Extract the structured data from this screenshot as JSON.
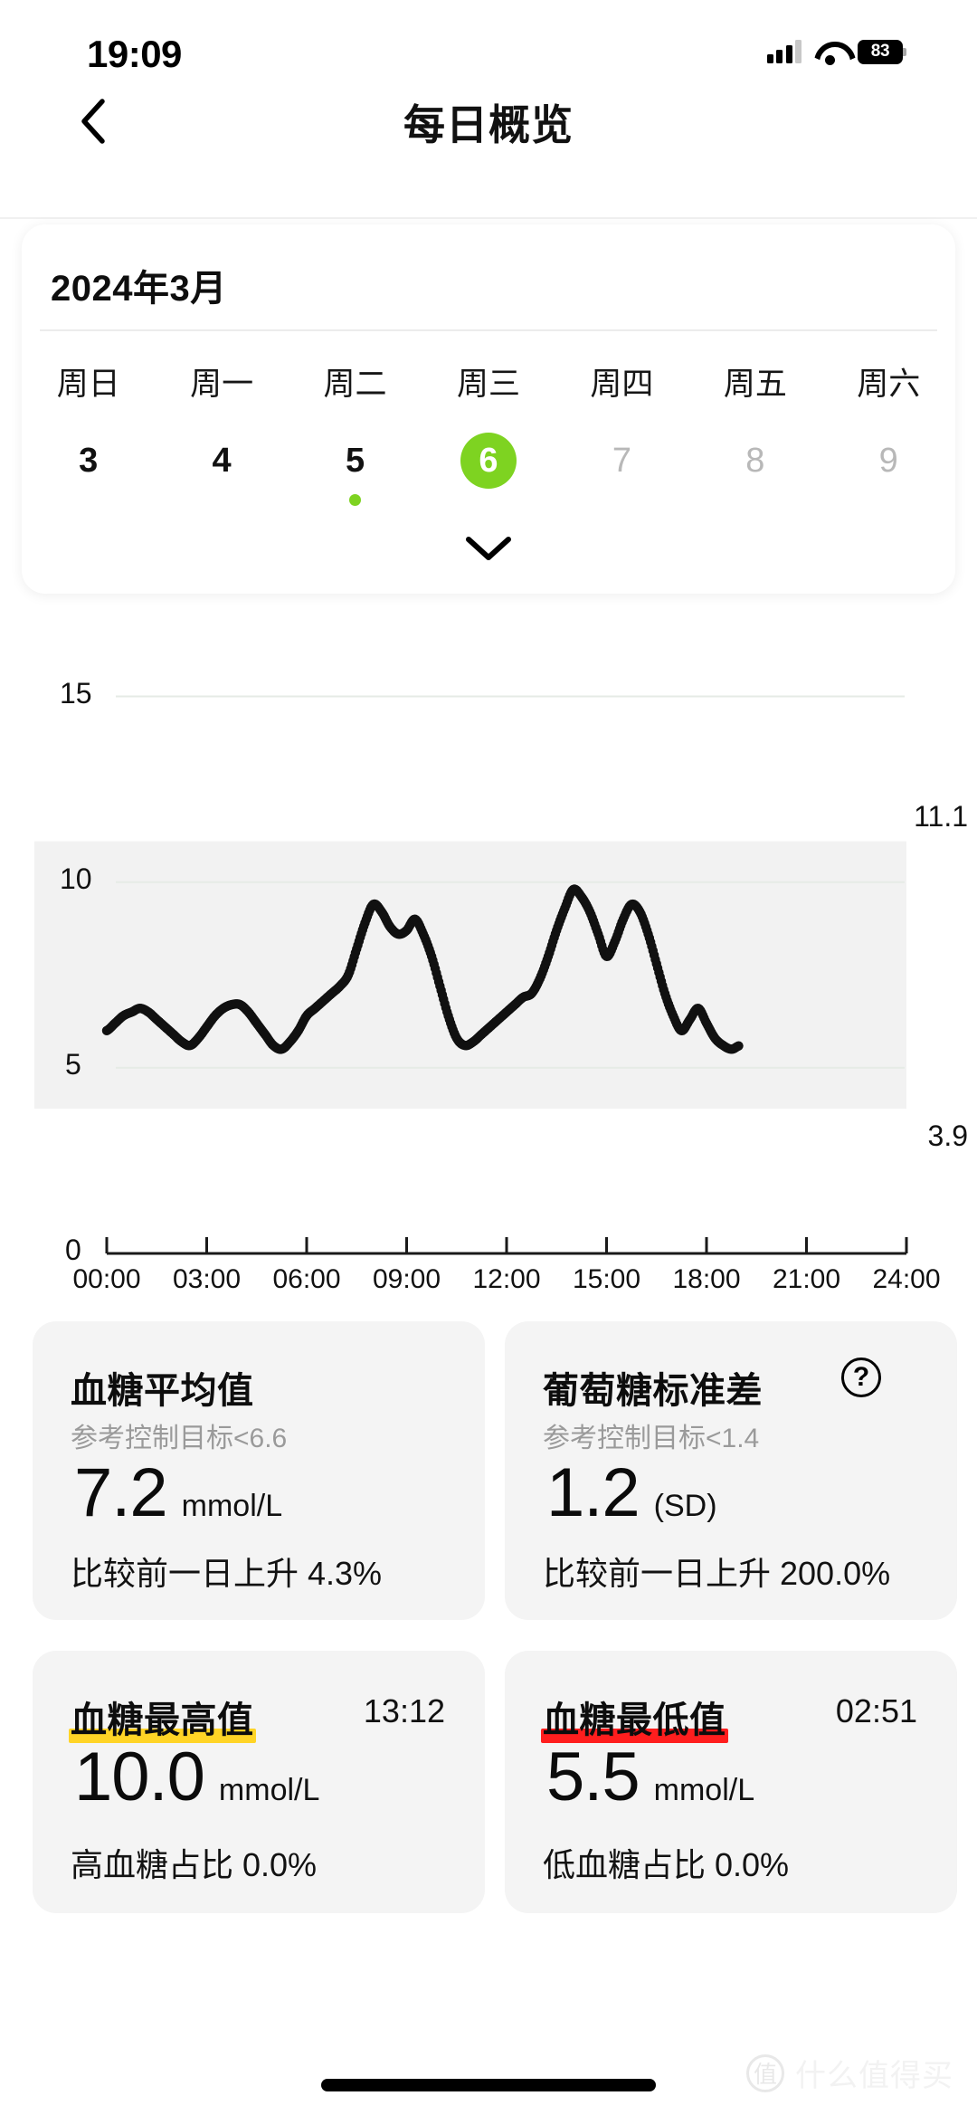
{
  "status_bar": {
    "time": "19:09",
    "battery": "83",
    "signal_icon": "cellular-signal-icon",
    "wifi_icon": "wifi-icon",
    "battery_icon": "battery-icon"
  },
  "nav": {
    "title": "每日概览",
    "back_icon": "chevron-left-icon"
  },
  "calendar": {
    "month": "2024年3月",
    "weekdays": [
      "周日",
      "周一",
      "周二",
      "周三",
      "周四",
      "周五",
      "周六"
    ],
    "days": [
      {
        "num": "3",
        "state": "normal",
        "dot": false
      },
      {
        "num": "4",
        "state": "normal",
        "dot": false
      },
      {
        "num": "5",
        "state": "normal",
        "dot": true
      },
      {
        "num": "6",
        "state": "selected",
        "dot": false
      },
      {
        "num": "7",
        "state": "dim",
        "dot": false
      },
      {
        "num": "8",
        "state": "dim",
        "dot": false
      },
      {
        "num": "9",
        "state": "dim",
        "dot": false
      }
    ],
    "expand_icon": "chevron-down-icon",
    "selected_color": "#7ED321",
    "dot_color": "#7ED321"
  },
  "chart_data": {
    "type": "line",
    "title": "",
    "xlabel": "",
    "ylabel": "mmol/L",
    "ylim": [
      0,
      16.5
    ],
    "yticks": [
      0,
      5,
      10,
      15
    ],
    "ytick_labels": [
      "0",
      "5",
      "10",
      "15"
    ],
    "target_range": {
      "low": 3.9,
      "high": 11.1,
      "low_label": "3.9",
      "high_label": "11.1",
      "band_color": "#f2f2f2"
    },
    "xticks": [
      "00:00",
      "03:00",
      "06:00",
      "09:00",
      "12:00",
      "15:00",
      "18:00",
      "21:00",
      "24:00"
    ],
    "xlim_hours": [
      0,
      24
    ],
    "grid": true,
    "marker": "dot",
    "series_color": "#111111",
    "series": [
      {
        "name": "血糖",
        "unit": "mmol/L",
        "x_hours": [
          0.0,
          0.25,
          0.5,
          0.75,
          1.0,
          1.25,
          1.5,
          1.75,
          2.0,
          2.25,
          2.5,
          2.75,
          3.0,
          3.25,
          3.5,
          3.75,
          4.0,
          4.25,
          4.5,
          4.75,
          5.0,
          5.25,
          5.5,
          5.75,
          6.0,
          6.25,
          6.5,
          6.75,
          7.0,
          7.25,
          7.5,
          7.75,
          8.0,
          8.25,
          8.5,
          8.75,
          9.0,
          9.25,
          9.5,
          9.75,
          10.0,
          10.25,
          10.5,
          10.75,
          11.0,
          11.25,
          11.5,
          11.75,
          12.0,
          12.25,
          12.5,
          12.75,
          13.0,
          13.25,
          13.5,
          13.75,
          14.0,
          14.25,
          14.5,
          14.75,
          15.0,
          15.25,
          15.5,
          15.75,
          16.0,
          16.25,
          16.5,
          16.75,
          17.0,
          17.25,
          17.5,
          17.75,
          18.0,
          18.25,
          18.5,
          18.75,
          19.0
        ],
        "values": [
          6.0,
          6.2,
          6.4,
          6.5,
          6.6,
          6.5,
          6.3,
          6.1,
          5.9,
          5.7,
          5.6,
          5.8,
          6.1,
          6.4,
          6.6,
          6.7,
          6.7,
          6.5,
          6.2,
          5.9,
          5.6,
          5.5,
          5.7,
          6.0,
          6.4,
          6.6,
          6.8,
          7.0,
          7.2,
          7.5,
          8.2,
          8.9,
          9.4,
          9.2,
          8.8,
          8.6,
          8.7,
          9.0,
          8.6,
          8.0,
          7.2,
          6.4,
          5.8,
          5.6,
          5.7,
          5.9,
          6.1,
          6.3,
          6.5,
          6.7,
          6.9,
          7.0,
          7.4,
          8.0,
          8.7,
          9.3,
          9.8,
          9.6,
          9.2,
          8.6,
          8.0,
          8.4,
          9.0,
          9.4,
          9.2,
          8.6,
          7.8,
          7.0,
          6.4,
          6.0,
          6.3,
          6.6,
          6.2,
          5.8,
          5.6,
          5.5,
          5.6
        ]
      }
    ]
  },
  "stats": [
    {
      "id": "average-glucose",
      "title": "血糖平均值",
      "title_highlight": "none",
      "subtitle": "参考控制目标<6.6",
      "value": "7.2",
      "unit": "mmol/L",
      "footer": "比较前一日上升 4.3%",
      "time": "",
      "help_icon": false
    },
    {
      "id": "glucose-sd",
      "title": "葡萄糖标准差",
      "title_highlight": "none",
      "subtitle": "参考控制目标<1.4",
      "value": "1.2",
      "unit": "(SD)",
      "footer": "比较前一日上升 200.0%",
      "time": "",
      "help_icon": true,
      "help_label": "?"
    },
    {
      "id": "max-glucose",
      "title": "血糖最高值",
      "title_highlight": "yellow",
      "subtitle": "",
      "value": "10.0",
      "unit": "mmol/L",
      "footer": "高血糖占比 0.0%",
      "time": "13:12",
      "help_icon": false
    },
    {
      "id": "min-glucose",
      "title": "血糖最低值",
      "title_highlight": "red",
      "subtitle": "",
      "value": "5.5",
      "unit": "mmol/L",
      "footer": "低血糖占比 0.0%",
      "time": "02:51",
      "help_icon": false
    }
  ],
  "watermark": {
    "logo": "值",
    "text": "什么值得买"
  }
}
